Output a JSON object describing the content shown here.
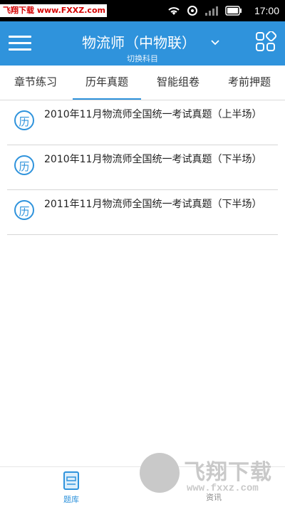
{
  "status_bar": {
    "watermark": "飞翔下载 www.FXXZ.com",
    "time": "17:00",
    "icons": [
      "wifi-icon",
      "signal-icon",
      "battery-icon"
    ]
  },
  "header": {
    "title": "物流师（中物联）",
    "subtitle": "切换科目",
    "accent_color": "#2f93dc"
  },
  "tabs": [
    {
      "label": "章节练习",
      "active": false
    },
    {
      "label": "历年真题",
      "active": true
    },
    {
      "label": "智能组卷",
      "active": false
    },
    {
      "label": "考前押题",
      "active": false
    }
  ],
  "list": {
    "badge": "历",
    "items": [
      {
        "title": "2010年11月物流师全国统一考试真题（上半场）"
      },
      {
        "title": "2010年11月物流师全国统一考试真题（下半场）"
      },
      {
        "title": "2011年11月物流师全国统一考试真题（下半场）"
      }
    ]
  },
  "bottom_nav": [
    {
      "label": "题库",
      "active": true
    },
    {
      "label": "资讯",
      "active": false
    }
  ],
  "watermark_bottom": {
    "title": "飞翔下载",
    "url": "www.fxxz.com"
  }
}
